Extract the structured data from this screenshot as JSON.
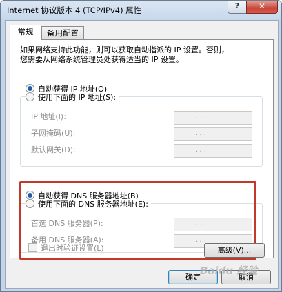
{
  "window": {
    "title": "Internet 协议版本 4 (TCP/IPv4) 属性",
    "help_label": "?",
    "close_label": "✕"
  },
  "tabs": [
    {
      "label": "常规",
      "active": true
    },
    {
      "label": "备用配置",
      "active": false
    }
  ],
  "description": {
    "line1": "如果网络支持此功能，则可以获取自动指派的 IP 设置。否则，",
    "line2": "您需要从网络系统管理员处获得适当的 IP 设置。"
  },
  "ip_section": {
    "auto_label": "自动获得 IP 地址(O)",
    "manual_label": "使用下面的 IP 地址(S):",
    "selected": "auto",
    "fields": [
      {
        "label": "IP 地址(I):",
        "value": ".   .   ."
      },
      {
        "label": "子网掩码(U):",
        "value": ".   .   ."
      },
      {
        "label": "默认网关(D):",
        "value": ".   .   ."
      }
    ]
  },
  "dns_section": {
    "auto_label": "自动获得 DNS 服务器地址(B)",
    "manual_label": "使用下面的 DNS 服务器地址(E):",
    "selected": "auto",
    "fields": [
      {
        "label": "首选 DNS 服务器(P):",
        "value": ".   .   ."
      },
      {
        "label": "备用 DNS 服务器(A):",
        "value": ".   .   ."
      }
    ]
  },
  "validate_checkbox": {
    "label": "退出时验证设置(L)",
    "checked": false
  },
  "buttons": {
    "advanced": "高级(V)...",
    "ok": "确定",
    "cancel": "取消"
  },
  "watermark": "Baidu 经验",
  "colors": {
    "highlight_frame": "#c0392b",
    "radio_selected": "#1f5ea8",
    "title_gradient_top": "#dbe6f3"
  }
}
